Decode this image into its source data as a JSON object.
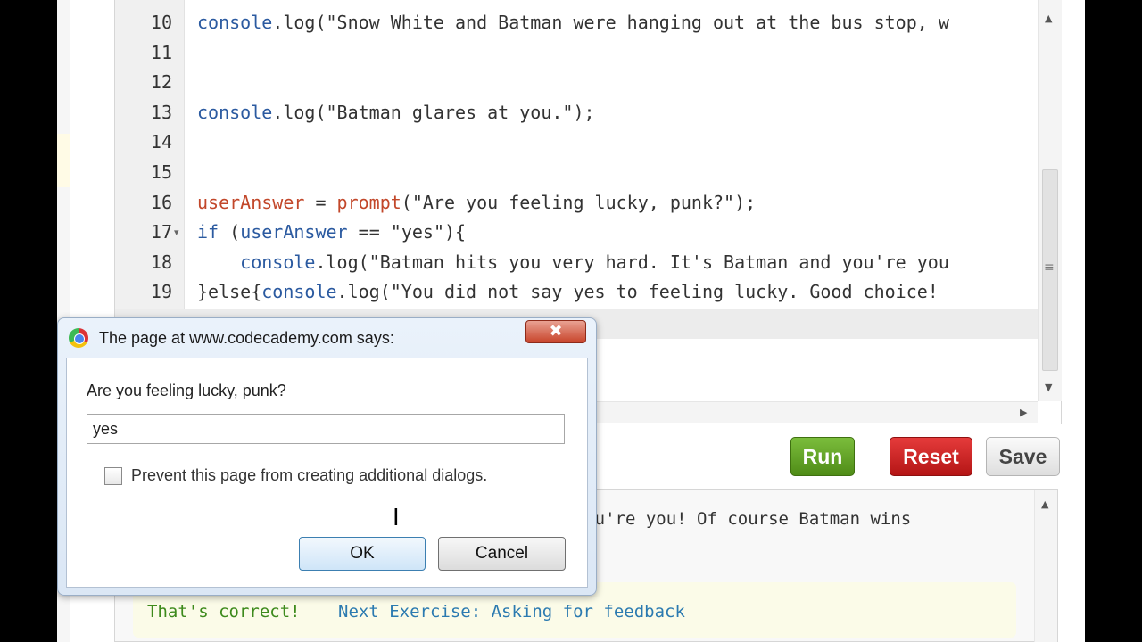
{
  "editor": {
    "lines": [
      {
        "num": "10",
        "fold": "",
        "parts": [
          {
            "t": "console",
            "c": "kw"
          },
          {
            "t": ".log(\"Snow White and Batman were hanging out at the bus stop, w",
            "c": ""
          }
        ]
      },
      {
        "num": "11",
        "fold": "",
        "parts": []
      },
      {
        "num": "12",
        "fold": "",
        "parts": []
      },
      {
        "num": "13",
        "fold": "",
        "parts": [
          {
            "t": "console",
            "c": "kw"
          },
          {
            "t": ".log(\"Batman glares at you.\");",
            "c": ""
          }
        ]
      },
      {
        "num": "14",
        "fold": "",
        "parts": []
      },
      {
        "num": "15",
        "fold": "",
        "parts": []
      },
      {
        "num": "16",
        "fold": "",
        "parts": [
          {
            "t": "userAnswer",
            "c": "fn"
          },
          {
            "t": " = ",
            "c": ""
          },
          {
            "t": "prompt",
            "c": "fn"
          },
          {
            "t": "(\"Are you feeling lucky, punk?\");",
            "c": ""
          }
        ]
      },
      {
        "num": "17",
        "fold": "▾",
        "parts": [
          {
            "t": "if",
            "c": "kw"
          },
          {
            "t": " (",
            "c": ""
          },
          {
            "t": "userAnswer",
            "c": "kw"
          },
          {
            "t": " == \"yes\"){",
            "c": ""
          }
        ]
      },
      {
        "num": "18",
        "fold": "",
        "parts": [
          {
            "t": "    ",
            "c": ""
          },
          {
            "t": "console",
            "c": "kw"
          },
          {
            "t": ".log(\"Batman hits you very hard. It's Batman and you're you",
            "c": ""
          }
        ]
      },
      {
        "num": "19",
        "fold": "",
        "parts": [
          {
            "t": "}else{",
            "c": ""
          },
          {
            "t": "console",
            "c": "kw"
          },
          {
            "t": ".log(\"You did not say yes to feeling lucky. Good choice!",
            "c": ""
          }
        ]
      }
    ],
    "scroll_up_glyph": "▲",
    "scroll_down_glyph": "▼",
    "scroll_right_glyph": "▶",
    "grip_glyph": "≡"
  },
  "buttons": {
    "run": "Run",
    "reset": "Reset",
    "save": "Save"
  },
  "console": {
    "output_line": "                                          nd you're you! Of course Batman wins",
    "scroll_up_glyph": "▲",
    "feedback_text": "That's correct!",
    "feedback_link": "Next Exercise: Asking for feedback"
  },
  "dialog": {
    "title": "The page at www.codecademy.com says:",
    "close_glyph": "✖",
    "prompt": "Are you feeling lucky, punk?",
    "input_value": "yes",
    "checkbox_label": "Prevent this page from creating additional dialogs.",
    "ok_label": "OK",
    "cancel_label": "Cancel"
  },
  "cursor_glyph": "I",
  "colors": {
    "run": "#5a9a1e",
    "reset": "#c91f1f",
    "keyword": "#2b5aa0",
    "identifier": "#c2472a",
    "feedback_ok": "#3d8a1c",
    "feedback_link": "#2b7ab0"
  }
}
